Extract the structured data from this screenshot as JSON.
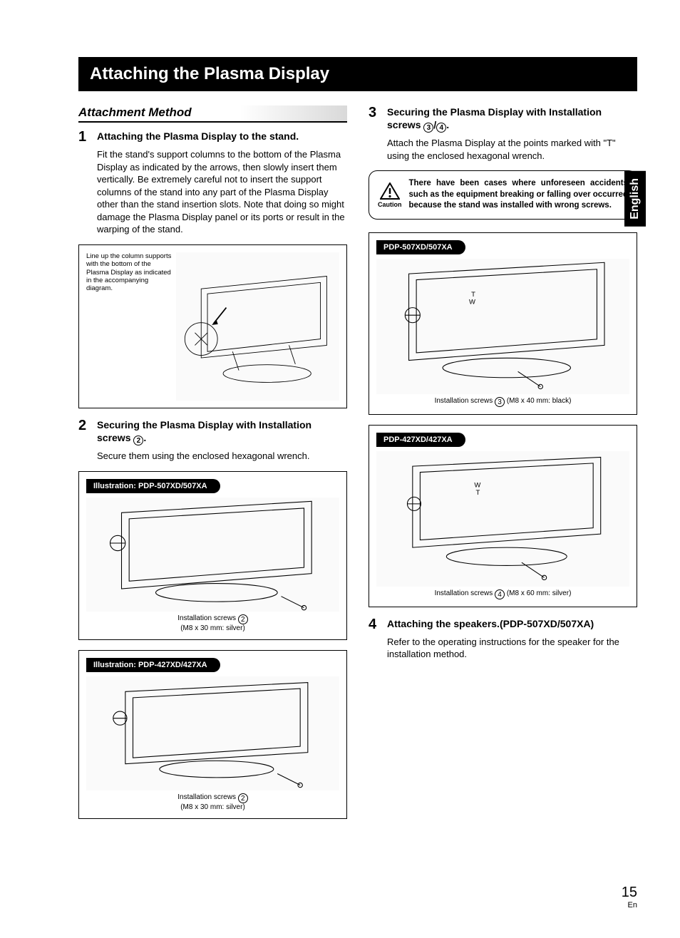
{
  "title": "Attaching the Plasma Display",
  "section_head": "Attachment Method",
  "lang_tab": "English",
  "page": {
    "num": "15",
    "lang": "En"
  },
  "left": {
    "step1": {
      "num": "1",
      "title": "Attaching the Plasma Display to the stand.",
      "body": "Fit the stand's support columns to the bottom of the Plasma Display as indicated by the arrows, then slowly insert them vertically. Be extremely careful not to insert the support columns of the stand into any part of the Plasma Display other than the stand insertion slots. Note that doing so might damage the Plasma Display panel or its ports or result in the warping of the stand.",
      "fig_note": "Line up the column supports with the bottom of the Plasma Display as indicated in the accompanying diagram."
    },
    "step2": {
      "num": "2",
      "title_a": "Securing the Plasma Display with Installation screws ",
      "title_b": ".",
      "circ": "2",
      "body": "Secure them using the enclosed hexagonal wrench.",
      "fig_a_tag": "Illustration: PDP-507XD/507XA",
      "fig_a_cap_a": "Installation screws ",
      "fig_a_cap_b": "(M8 x 30 mm: silver)",
      "fig_b_tag": "Illustration: PDP-427XD/427XA",
      "fig_b_cap_a": "Installation screws ",
      "fig_b_cap_b": "(M8 x 30 mm: silver)"
    }
  },
  "right": {
    "step3": {
      "num": "3",
      "title_a": "Securing the Plasma Display with Installation screws ",
      "circ1": "3",
      "sep": "/",
      "circ2": "4",
      "title_b": ".",
      "body": "Attach the Plasma Display at the points marked with \"T\" using the enclosed hexagonal wrench.",
      "caution_label": "Caution",
      "caution_text": "There have been cases where unforeseen accidents such as the equipment breaking or falling over occurred because the stand was installed with wrong screws.",
      "fig_a_tag": "PDP-507XD/507XA",
      "fig_a_cap_a": "Installation screws ",
      "fig_a_circ": "3",
      "fig_a_cap_b": " (M8 x 40 mm: black)",
      "fig_b_tag": "PDP-427XD/427XA",
      "fig_b_cap_a": "Installation screws ",
      "fig_b_circ": "4",
      "fig_b_cap_b": " (M8 x 60 mm: silver)"
    },
    "step4": {
      "num": "4",
      "title": "Attaching the speakers.(PDP-507XD/507XA)",
      "body": "Refer to the operating instructions for the speaker for the installation method."
    }
  }
}
